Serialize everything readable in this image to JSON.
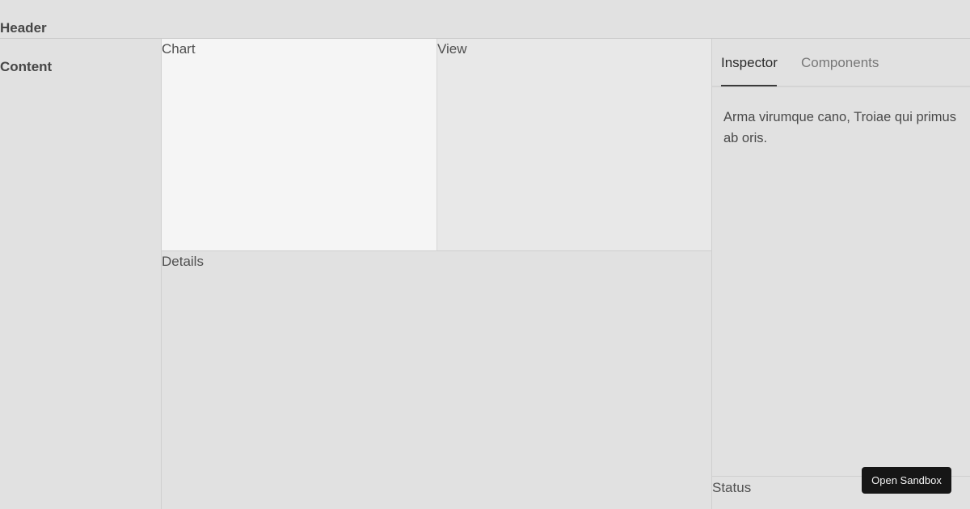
{
  "header": {
    "label": "Header"
  },
  "sidebar": {
    "label": "Content"
  },
  "panels": {
    "chart": "Chart",
    "view": "View",
    "details": "Details"
  },
  "inspector": {
    "tabs": [
      "Inspector",
      "Components"
    ],
    "active_tab": "Inspector",
    "body_text": "Arma virumque cano, Troiae qui primus ab oris."
  },
  "status": {
    "label": "Status"
  },
  "actions": {
    "open_sandbox": "Open Sandbox"
  }
}
